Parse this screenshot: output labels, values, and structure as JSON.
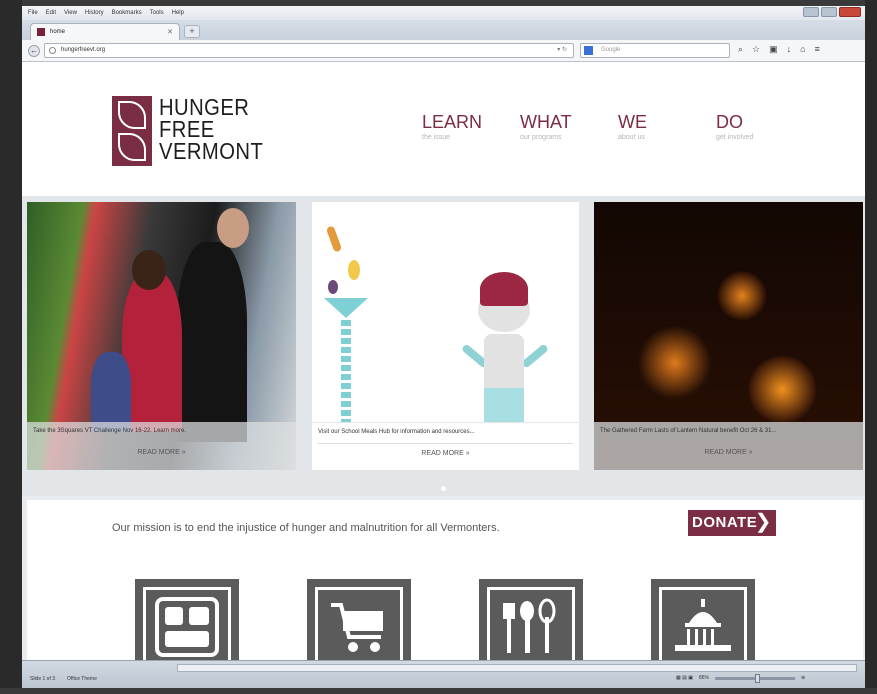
{
  "browser": {
    "menu": [
      "File",
      "Edit",
      "View",
      "History",
      "Bookmarks",
      "Tools",
      "Help"
    ],
    "tab_title": "home",
    "url": "hungerfreevt.org",
    "search_placeholder": "Google"
  },
  "site": {
    "logo_lines": [
      "HUNGER",
      "FREE",
      "VERMONT"
    ],
    "nav": [
      {
        "label": "LEARN",
        "sub": "the issue"
      },
      {
        "label": "WHAT",
        "sub": "our programs"
      },
      {
        "label": "WE",
        "sub": "about us"
      },
      {
        "label": "DO",
        "sub": "get involved"
      }
    ],
    "slides": [
      {
        "caption": "Take the 3Squares VT Challenge Nov 16-22. Learn more.",
        "more": "READ MORE »"
      },
      {
        "caption": "Visit our School Meals Hub for information and resources...",
        "more": "READ MORE »"
      },
      {
        "caption": "The Gathered Farm Lasts of Lantern Natural benefit Oct 26 & 31...",
        "more": "READ MORE »"
      }
    ],
    "mission": "Our mission is to end the injustice of hunger and malnutrition for all Vermonters.",
    "donate": "DONATE"
  },
  "status": {
    "left": [
      "Slide 1 of 3",
      "Office Theme"
    ],
    "zoom": "86%"
  },
  "colors": {
    "brand": "#7b2d43",
    "tile": "#5b5b5b"
  }
}
